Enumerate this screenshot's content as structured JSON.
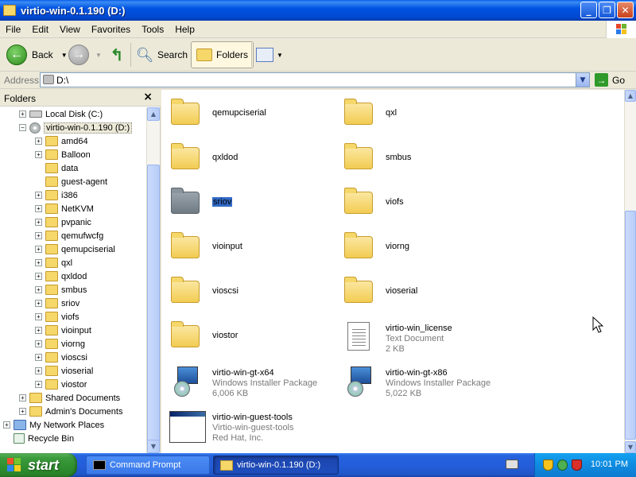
{
  "window": {
    "title": "virtio-win-0.1.190 (D:)"
  },
  "menu": [
    "File",
    "Edit",
    "View",
    "Favorites",
    "Tools",
    "Help"
  ],
  "toolbar": {
    "back_label": "Back",
    "search_label": "Search",
    "folders_label": "Folders"
  },
  "address": {
    "label": "Address",
    "value": "D:\\",
    "go_label": "Go"
  },
  "folders_pane": {
    "title": "Folders",
    "tree": [
      {
        "label": "Local Disk (C:)",
        "icon": "drive",
        "expander": "+",
        "indent": 1
      },
      {
        "label": "virtio-win-0.1.190 (D:)",
        "icon": "cd",
        "expander": "-",
        "indent": 1,
        "selected": true
      },
      {
        "label": "amd64",
        "icon": "folder",
        "expander": "+",
        "indent": 2
      },
      {
        "label": "Balloon",
        "icon": "folder",
        "expander": "+",
        "indent": 2
      },
      {
        "label": "data",
        "icon": "folder",
        "expander": "",
        "indent": 2
      },
      {
        "label": "guest-agent",
        "icon": "folder",
        "expander": "",
        "indent": 2
      },
      {
        "label": "i386",
        "icon": "folder",
        "expander": "+",
        "indent": 2
      },
      {
        "label": "NetKVM",
        "icon": "folder",
        "expander": "+",
        "indent": 2
      },
      {
        "label": "pvpanic",
        "icon": "folder",
        "expander": "+",
        "indent": 2
      },
      {
        "label": "qemufwcfg",
        "icon": "folder",
        "expander": "+",
        "indent": 2
      },
      {
        "label": "qemupciserial",
        "icon": "folder",
        "expander": "+",
        "indent": 2
      },
      {
        "label": "qxl",
        "icon": "folder",
        "expander": "+",
        "indent": 2
      },
      {
        "label": "qxldod",
        "icon": "folder",
        "expander": "+",
        "indent": 2
      },
      {
        "label": "smbus",
        "icon": "folder",
        "expander": "+",
        "indent": 2
      },
      {
        "label": "sriov",
        "icon": "folder",
        "expander": "+",
        "indent": 2
      },
      {
        "label": "viofs",
        "icon": "folder",
        "expander": "+",
        "indent": 2
      },
      {
        "label": "vioinput",
        "icon": "folder",
        "expander": "+",
        "indent": 2
      },
      {
        "label": "viorng",
        "icon": "folder",
        "expander": "+",
        "indent": 2
      },
      {
        "label": "vioscsi",
        "icon": "folder",
        "expander": "+",
        "indent": 2
      },
      {
        "label": "vioserial",
        "icon": "folder",
        "expander": "+",
        "indent": 2
      },
      {
        "label": "viostor",
        "icon": "folder",
        "expander": "+",
        "indent": 2
      },
      {
        "label": "Shared Documents",
        "icon": "folder",
        "expander": "+",
        "indent": 1
      },
      {
        "label": "Admin's Documents",
        "icon": "folder",
        "expander": "+",
        "indent": 1
      },
      {
        "label": "My Network Places",
        "icon": "net",
        "expander": "+",
        "indent": 0
      },
      {
        "label": "Recycle Bin",
        "icon": "bin",
        "expander": "",
        "indent": 0
      }
    ]
  },
  "content": {
    "items": [
      {
        "name": "qemupciserial",
        "type": "folder"
      },
      {
        "name": "qxl",
        "type": "folder"
      },
      {
        "name": "qxldod",
        "type": "folder"
      },
      {
        "name": "smbus",
        "type": "folder"
      },
      {
        "name": "sriov",
        "type": "folder-selected"
      },
      {
        "name": "viofs",
        "type": "folder"
      },
      {
        "name": "vioinput",
        "type": "folder"
      },
      {
        "name": "viorng",
        "type": "folder"
      },
      {
        "name": "vioscsi",
        "type": "folder"
      },
      {
        "name": "vioserial",
        "type": "folder"
      },
      {
        "name": "viostor",
        "type": "folder"
      },
      {
        "name": "virtio-win_license",
        "type": "text",
        "line2": "Text Document",
        "line3": "2 KB"
      },
      {
        "name": "virtio-win-gt-x64",
        "type": "msi",
        "line2": "Windows Installer Package",
        "line3": "6,006 KB"
      },
      {
        "name": "virtio-win-gt-x86",
        "type": "msi",
        "line2": "Windows Installer Package",
        "line3": "5,022 KB"
      },
      {
        "name": "virtio-win-guest-tools",
        "type": "exe",
        "line2": "Virtio-win-guest-tools",
        "line3": "Red Hat, Inc."
      }
    ]
  },
  "taskbar": {
    "start_label": "start",
    "tasks": [
      {
        "label": "Command Prompt",
        "active": false
      },
      {
        "label": "virtio-win-0.1.190 (D:)",
        "active": true
      }
    ],
    "clock": "10:01 PM"
  },
  "colors": {
    "titlebar": "#0053e1",
    "selection": "#316ac5",
    "start_green": "#3c9b3c",
    "taskbar_blue": "#245edb"
  }
}
